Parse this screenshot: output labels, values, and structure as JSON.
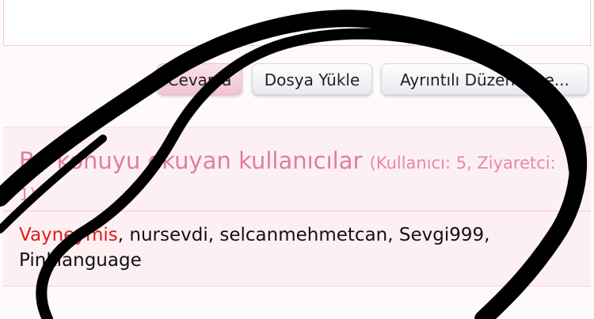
{
  "buttons": {
    "reply": "Cevapla",
    "upload": "Dosya Yükle",
    "advanced": "Ayrıntılı Düzenleme..."
  },
  "viewers": {
    "title": "Bu konuyu okuyan kullanıcılar",
    "count": "(Kullanıcı: 5, Ziyaretci: 1)",
    "users": [
      {
        "name": "Vayneymis",
        "separator": ", ",
        "color": "#e01b1b"
      },
      {
        "name": "nursevdi",
        "separator": ", "
      },
      {
        "name": "selcanmehmetcan",
        "separator": ", "
      },
      {
        "name": "Sevgi999",
        "separator": ", "
      },
      {
        "name": "Pinklanguage",
        "separator": ""
      }
    ]
  },
  "colors": {
    "accent": "#e07e9c",
    "highlight_user": "#e01b1b",
    "scribble": "#000000"
  }
}
